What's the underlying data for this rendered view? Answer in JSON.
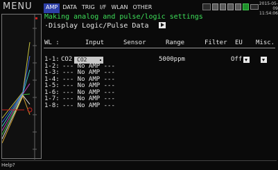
{
  "header": {
    "menu_title": "MENU",
    "tabs": [
      {
        "label": "AMP",
        "active": true
      },
      {
        "label": "DATA",
        "active": false
      },
      {
        "label": "TRIG",
        "active": false
      },
      {
        "label": "I/F",
        "active": false
      },
      {
        "label": "WLAN",
        "active": false
      },
      {
        "label": "OTHER",
        "active": false
      }
    ],
    "date": "2015-05-09",
    "time": "11:54:06"
  },
  "content": {
    "heading": "Making analog and pulse/logic settings",
    "sub_label": "·Display Logic/Pulse Data"
  },
  "table": {
    "headers": {
      "wl": "WL :",
      "input": "Input",
      "sensor": "Sensor",
      "range": "Range",
      "filter": "Filter",
      "eu": "EU",
      "misc": "Misc."
    },
    "rows": [
      {
        "channel": "1-1:",
        "name": "CO2",
        "input": "CO2",
        "range": "5000ppm",
        "eu": "Off"
      },
      {
        "channel": "1-2:",
        "status": "--- No AMP ---"
      },
      {
        "channel": "1-3:",
        "status": "--- No AMP ---"
      },
      {
        "channel": "1-4:",
        "status": "--- No AMP ---"
      },
      {
        "channel": "1-5:",
        "status": "--- No AMP ---"
      },
      {
        "channel": "1-6:",
        "status": "--- No AMP ---"
      },
      {
        "channel": "1-7:",
        "status": "--- No AMP ---"
      },
      {
        "channel": "1-8:",
        "status": "--- No AMP ---"
      }
    ]
  },
  "footer": {
    "help": "Help?"
  },
  "colors": {
    "accent_tab": "#2d3fa8",
    "heading_green": "#3ee05a",
    "background": "#0a0a0a"
  }
}
